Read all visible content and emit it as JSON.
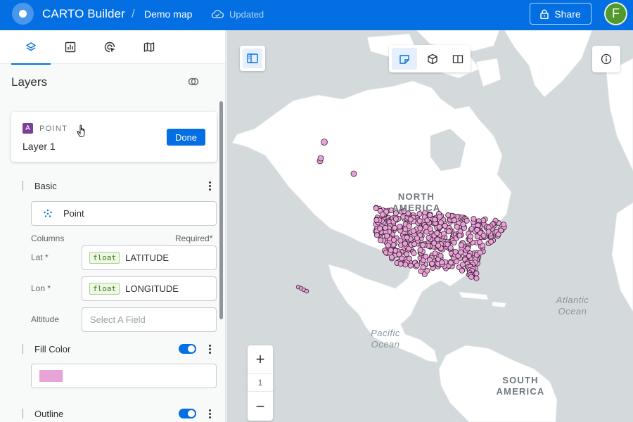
{
  "header": {
    "app_title": "CARTO Builder",
    "separator": "/",
    "map_name": "Demo map",
    "status": "Updated",
    "share_label": "Share",
    "avatar_initial": "F"
  },
  "panel": {
    "tabs": [
      "layers-icon",
      "widgets-icon",
      "interactions-icon",
      "basemap-icon"
    ],
    "title": "Layers",
    "layer": {
      "badge": "A",
      "type": "POINT",
      "name": "Layer 1",
      "done_label": "Done"
    },
    "basic": {
      "title": "Basic",
      "geometry_type": "Point",
      "columns_label": "Columns",
      "required_label": "Required*",
      "lat_label": "Lat *",
      "lat_type": "float",
      "lat_value": "LATITUDE",
      "lon_label": "Lon *",
      "lon_type": "float",
      "lon_value": "LONGITUDE",
      "altitude_label": "Altitude",
      "altitude_placeholder": "Select A Field"
    },
    "fill": {
      "title": "Fill Color",
      "enabled": true,
      "color": "#e8a3d6"
    },
    "outline": {
      "title": "Outline",
      "enabled": true
    }
  },
  "map": {
    "zoom_in": "+",
    "zoom_level": "1",
    "zoom_out": "−",
    "labels": {
      "north_america_1": "NORTH",
      "north_america_2": "AMERICA",
      "south_america_1": "SOUTH",
      "south_america_2": "AMERICA",
      "atlantic_1": "Atlantic",
      "atlantic_2": "Ocean",
      "pacific_1": "Pacific",
      "pacific_2": "Ocean"
    },
    "point_color": "#e8a3d6",
    "point_outline": "#3a1d33"
  },
  "colors": {
    "brand": "#036fe2",
    "land": "#ffffff",
    "water": "#d4dadc"
  }
}
